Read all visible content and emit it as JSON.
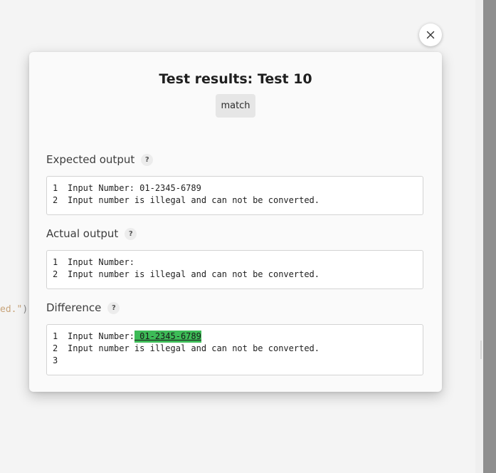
{
  "background": {
    "code_fragment": "ed.\"",
    "code_paren": ")"
  },
  "modal": {
    "title": "Test results: Test 10",
    "badge": "match",
    "help_glyph": "?",
    "close_icon": "close-icon",
    "expected": {
      "label": "Expected output",
      "lines": [
        {
          "num": "1",
          "text": "Input Number: 01-2345-6789"
        },
        {
          "num": "2",
          "text": "Input number is illegal and can not be converted."
        }
      ]
    },
    "actual": {
      "label": "Actual output",
      "lines": [
        {
          "num": "1",
          "text": "Input Number:"
        },
        {
          "num": "2",
          "text": "Input number is illegal and can not be converted."
        }
      ]
    },
    "difference": {
      "label": "Difference",
      "line1_num": "1",
      "line1_prefix": "Input Number:",
      "line1_added": " 01-2345-6789",
      "line2_num": "2",
      "line2_text": "Input number is illegal and can not be converted.",
      "line3_num": "3"
    }
  },
  "colors": {
    "diff_added": "#3dbb57",
    "modal_bg": "#fafafa",
    "page_bg": "#f4f4f4"
  }
}
